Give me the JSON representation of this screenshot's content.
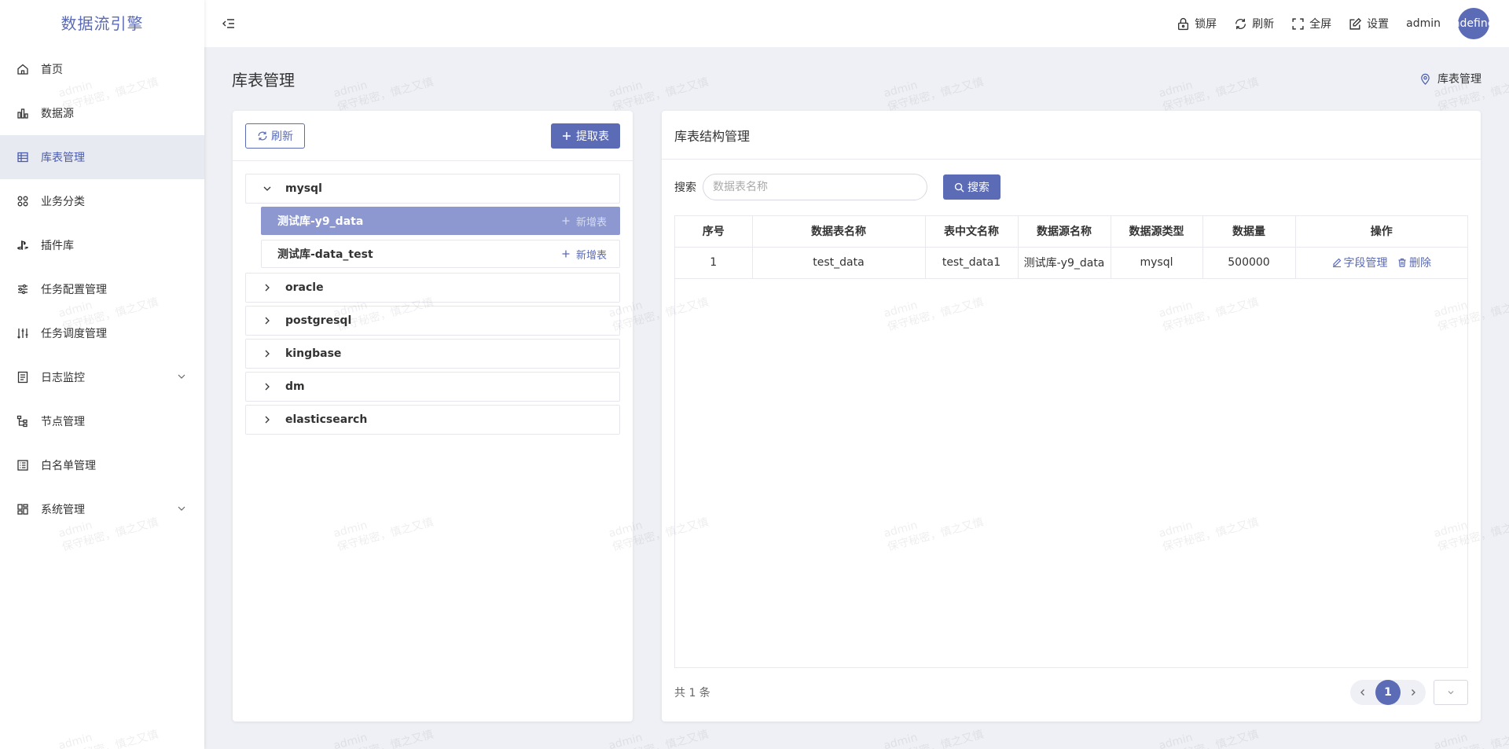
{
  "app": {
    "title": "数据流引擎"
  },
  "sidebar": {
    "items": [
      {
        "label": "首页",
        "icon": "home-icon"
      },
      {
        "label": "数据源",
        "icon": "bar-chart-icon"
      },
      {
        "label": "库表管理",
        "icon": "table-icon",
        "active": true
      },
      {
        "label": "业务分类",
        "icon": "grid-circles-icon"
      },
      {
        "label": "插件库",
        "icon": "playstation-icon"
      },
      {
        "label": "任务配置管理",
        "icon": "sliders-icon"
      },
      {
        "label": "任务调度管理",
        "icon": "schedule-sort-icon"
      },
      {
        "label": "日志监控",
        "icon": "log-icon",
        "expandable": true
      },
      {
        "label": "节点管理",
        "icon": "tree-icon"
      },
      {
        "label": "白名单管理",
        "icon": "list-icon"
      },
      {
        "label": "系统管理",
        "icon": "dashboard-icon",
        "expandable": true
      }
    ]
  },
  "header": {
    "lock": "锁屏",
    "refresh": "刷新",
    "fullscreen": "全屏",
    "settings": "设置",
    "username": "admin",
    "avatar_text": "undefined"
  },
  "page": {
    "title": "库表管理",
    "breadcrumb": "库表管理"
  },
  "left_panel": {
    "refresh_label": "刷新",
    "extract_label": "提取表",
    "tree": [
      {
        "name": "mysql",
        "expanded": true,
        "children": [
          {
            "name": "测试库-y9_data",
            "action": "新增表",
            "selected": true
          },
          {
            "name": "测试库-data_test",
            "action": "新增表"
          }
        ]
      },
      {
        "name": "oracle"
      },
      {
        "name": "postgresql"
      },
      {
        "name": "kingbase"
      },
      {
        "name": "dm"
      },
      {
        "name": "elasticsearch"
      }
    ]
  },
  "right_panel": {
    "title": "库表结构管理",
    "search_label": "搜索",
    "search_placeholder": "数据表名称",
    "search_button": "搜索",
    "columns": [
      "序号",
      "数据表名称",
      "表中文名称",
      "数据源名称",
      "数据源类型",
      "数据量",
      "操作"
    ],
    "rows": [
      [
        "1",
        "test_data",
        "test_data1",
        "测试库-y9_data",
        "mysql",
        "500000"
      ]
    ],
    "row_actions": {
      "edit": "字段管理",
      "delete": "删除"
    },
    "total": "共 1 条",
    "current_page": "1"
  },
  "watermark": {
    "line1": "admin",
    "line2": "保守秘密，慎之又慎"
  },
  "colors": {
    "primary": "#5b6bb5",
    "selected": "#8c98cf",
    "background": "#eef0f5"
  }
}
